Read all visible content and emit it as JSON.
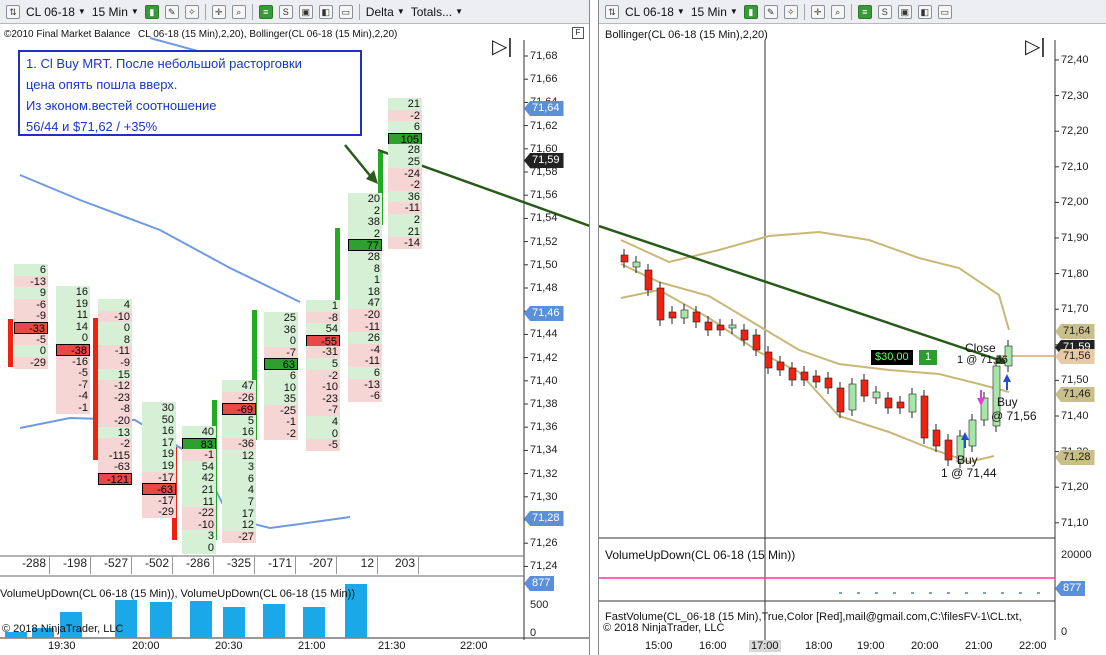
{
  "left": {
    "toolbar": {
      "instrument": "CL 06-18",
      "interval": "15 Min",
      "delta_menu": "Delta",
      "totals_menu": "Totals..."
    },
    "copyright_top": "©2010 Final Market Balance",
    "indicator_caption": "CL 06-18 (15 Min),2,20), Bollinger(CL 06-18 (15 Min),2,20)",
    "note_lines": [
      "1. Cl Buy MRT. После небольшой расторговки",
      "цена опять пошла вверх.",
      "Из эконом.вестей соотношение",
      "56/44 и $71,62 / +35%"
    ],
    "price_axis": [
      "71,68",
      "71,66",
      "71,64",
      "71,62",
      "71,60",
      "71,58",
      "71,56",
      "71,54",
      "71,52",
      "71,50",
      "71,48",
      "71,46",
      "71,44",
      "71,42",
      "71,40",
      "71,38",
      "71,36",
      "71,34",
      "71,32",
      "71,30",
      "71,28",
      "71,26",
      "71,24"
    ],
    "price_tags": [
      {
        "text": "71,64",
        "bg": "#5b8fd8",
        "fg": "#ffffff"
      },
      {
        "text": "71,59",
        "bg": "#222222",
        "fg": "#ffffff"
      },
      {
        "text": "71,46",
        "bg": "#5b8fd8",
        "fg": "#ffffff"
      },
      {
        "text": "71,28",
        "bg": "#5b8fd8",
        "fg": "#ffffff"
      }
    ],
    "delta_totals": [
      "-288",
      "-198",
      "-527",
      "-502",
      "-286",
      "-325",
      "-171",
      "-207",
      "12",
      "203"
    ],
    "volume_caption": "VolumeUpDown(CL 06-18 (15 Min)), VolumeUpDown(CL 06-18 (15 Min))",
    "volume_axis": [
      "500",
      "0"
    ],
    "volume_tag": "877",
    "copyright_bottom": "© 2018 NinjaTrader, LLC",
    "time_axis": [
      "19:30",
      "20:00",
      "20:30",
      "21:00",
      "21:30",
      "22:00"
    ],
    "footprint_columns": [
      {
        "cells": [
          "6",
          "-13",
          "9",
          "-6",
          "-9",
          "-33",
          "-5",
          "0",
          "-29"
        ],
        "boxed": "-33"
      },
      {
        "cells": [
          "16",
          "19",
          "11",
          "14",
          "0",
          "-38",
          "-16",
          "-5",
          "-7",
          "-4",
          "-1"
        ],
        "boxed": "-38"
      },
      {
        "cells": [
          "4",
          "-10",
          "0",
          "8",
          "-11",
          "-9",
          "15",
          "-12",
          "-23",
          "-8",
          "-20",
          "13",
          "-2",
          "-115",
          "-63",
          "-121"
        ],
        "boxed": "-121"
      },
      {
        "cells": [
          "30",
          "50",
          "16",
          "17",
          "19",
          "19",
          "-17",
          "-63",
          "-17",
          "-29"
        ],
        "boxed": "-63"
      },
      {
        "cells": [
          "40",
          "83",
          "-1",
          "54",
          "42",
          "21",
          "11",
          "-22",
          "-10",
          "3",
          "0"
        ],
        "boxed": "83"
      },
      {
        "cells": [
          "47",
          "-26",
          "-69",
          "5",
          "16",
          "-36",
          "12",
          "3",
          "6",
          "4",
          "7",
          "17",
          "12",
          "-27"
        ],
        "boxed": "-69"
      },
      {
        "cells": [
          "25",
          "36",
          "0",
          "-7",
          "63",
          "6",
          "10",
          "35",
          "-25",
          "-1",
          "-2"
        ],
        "boxed": "63"
      },
      {
        "cells": [
          "1",
          "-8",
          "54",
          "-55",
          "-31",
          "5",
          "-2",
          "-10",
          "-23",
          "-7",
          "4",
          "0",
          "-5"
        ],
        "boxed": "-55"
      },
      {
        "cells": [
          "20",
          "2",
          "38",
          "2",
          "77",
          "28",
          "8",
          "1",
          "18",
          "47",
          "-20",
          "-11",
          "26",
          "-4",
          "-11",
          "6",
          "-13",
          "-6"
        ],
        "boxed": "77"
      },
      {
        "cells": [
          "21",
          "-2",
          "6",
          "105",
          "28",
          "25",
          "-24",
          "-2",
          "36",
          "-11",
          "2",
          "21",
          "-14"
        ],
        "boxed": "105"
      }
    ]
  },
  "right": {
    "toolbar": {
      "instrument": "CL 06-18",
      "interval": "15 Min"
    },
    "indicator_caption": "Bollinger(CL 06-18 (15 Min),2,20)",
    "price_axis": [
      "72,40",
      "72,30",
      "72,20",
      "72,10",
      "72,00",
      "71,90",
      "71,80",
      "71,70",
      "71,60",
      "71,50",
      "71,40",
      "71,30",
      "71,20",
      "71,10"
    ],
    "price_tags": [
      {
        "text": "71,64",
        "bg": "#c8bf8a",
        "fg": "#222222"
      },
      {
        "text": "71,59",
        "bg": "#222222",
        "fg": "#ffffff"
      },
      {
        "text": "71,56",
        "bg": "#e7c9a6",
        "fg": "#222222"
      },
      {
        "text": "71,46",
        "bg": "#c8bf8a",
        "fg": "#222222"
      },
      {
        "text": "71,28",
        "bg": "#c8bf8a",
        "fg": "#222222"
      }
    ],
    "pnl_label": "$30,00",
    "position_qty": "1",
    "close_label": "Close",
    "close_detail": "1 @ 71,56",
    "buy1_label": "Buy",
    "buy1_detail": "@ 71,56",
    "buy2_label": "Buy",
    "buy2_detail": "1 @ 71,44",
    "volume_caption": "VolumeUpDown(CL 06-18 (15 Min))",
    "volume_axis": [
      "20000",
      "0"
    ],
    "volume_tag": "877",
    "fast_volume_caption": "FastVolume(CL_06-18 (15 Min),True,Color [Red],mail@gmail.com,C:\\filesFV-1\\CL.txt,",
    "copyright_bottom": "© 2018 NinjaTrader, LLC",
    "time_axis": [
      "15:00",
      "16:00",
      "17:00",
      "18:00",
      "19:00",
      "20:00",
      "21:00",
      "22:00"
    ]
  }
}
